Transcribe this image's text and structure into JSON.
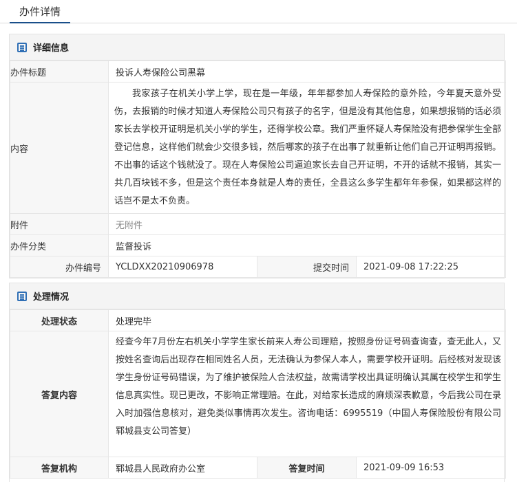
{
  "page": {
    "tab_title": "办件详情"
  },
  "detail": {
    "header": "详细信息",
    "title_label": "办件标题",
    "title_value": "投诉人寿保险公司黑幕",
    "content_label": "内容",
    "content_value": "我家孩子在机关小学上学，现在是一年级，年年都参加人寿保险的意外险，今年夏天意外受伤，去报销的时候才知道人寿保险公司只有孩子的名字，但是没有其他信息，如果想报销的话必须家长去学校开证明是机关小学的学生，还得学校公章。我们严重怀疑人寿保险没有把参保学生全部登记信息，这样他们就会少交很多钱，然后哪家的孩子在出事了就重新让他们自己开证明再报销。不出事的话这个钱就没了。现在人寿保险公司逼迫家长去自己开证明，不开的话就不报销，其实一共几百块钱不多，但是这个责任本身就是人寿的责任，全县这么多学生都年年参保，如果都这样的话岂不是太不负责。",
    "attachment_label": "附件",
    "attachment_value": "无附件",
    "category_label": "办件分类",
    "category_value": "监督投诉",
    "number_label": "办件编号",
    "number_value": "YCLDXX20210906978",
    "submit_time_label": "提交时间",
    "submit_time_value": "2021-09-08 17:22:25"
  },
  "handling": {
    "header": "处理情况",
    "status_label": "处理状态",
    "status_value": "处理完毕",
    "reply_label": "答复内容",
    "reply_value": "经查今年7月份左右机关小学学生家长前来人寿公司理赔，按照身份证号码查询查，查无此人，又按姓名查询后出现存在相同姓名人员，无法确认为参保人本人，需要学校开证明。后经核对发现该学生身份证号码错误，为了维护被保险人合法权益，故需请学校出具证明确认其属在校学生和学生信息真实性。现已更改，不影响正常理赔。在此，对给家长造成的麻烦深表歉意，今后我公司在录入时加强信息核对，避免类似事情再次发生。咨询电话：6995519（中国人寿保险股份有限公司郓城县支公司答复）",
    "agency_label": "答复机构",
    "agency_value": "郓城县人民政府办公室",
    "reply_time_label": "答复时间",
    "reply_time_value": "2021-09-09 16:53"
  },
  "icons": {
    "section_icon": "list-doc-icon",
    "accent_color": "#2f6fb5"
  }
}
